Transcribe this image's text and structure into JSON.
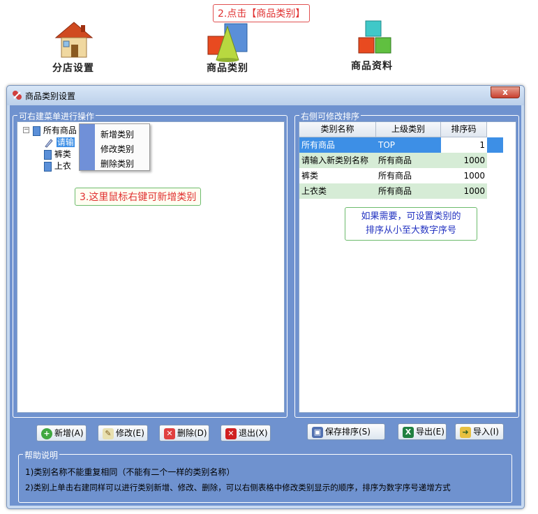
{
  "launcher": {
    "branch_label": "分店设置",
    "category_label": "商品类别",
    "goods_label": "商品资料"
  },
  "annotations": {
    "step2": "2.点击【商品类别】",
    "step3": "3.这里鼠标右键可新增类别",
    "sort_hint_line1": "如果需要，可设置类别的",
    "sort_hint_line2": "排序从小至大数字序号"
  },
  "window": {
    "title": "商品类别设置",
    "close_glyph": "x"
  },
  "tree_panel": {
    "title": "可右建菜单进行操作",
    "root": "所有商品",
    "children": [
      "请输",
      "裤类",
      "上衣"
    ]
  },
  "context_menu": {
    "items": [
      "新增类别",
      "修改类别",
      "删除类别"
    ]
  },
  "sort_panel": {
    "title": "右侧可修改排序",
    "columns": [
      "类别名称",
      "上级类别",
      "排序码"
    ],
    "rows": [
      {
        "name": "所有商品",
        "parent": "TOP",
        "order": "1"
      },
      {
        "name": "请输入新类别名称",
        "parent": "所有商品",
        "order": "1000"
      },
      {
        "name": "裤类",
        "parent": "所有商品",
        "order": "1000"
      },
      {
        "name": "上衣类",
        "parent": "所有商品",
        "order": "1000"
      }
    ]
  },
  "buttons": {
    "add": "新增(A)",
    "edit": "修改(E)",
    "delete": "删除(D)",
    "exit": "退出(X)",
    "save_sort": "保存排序(S)",
    "export": "导出(E)",
    "import": "导入(I)"
  },
  "help": {
    "title": "帮助说明",
    "line1": "1)类别名称不能重复相同（不能有二个一样的类别名称）",
    "line2": "2)类别上单击右建同样可以进行类别新增、修改、删除，可以右侧表格中修改类别显示的顺序，排序为数字序号递增方式"
  },
  "colors": {
    "window_bg": "#6f92cf",
    "selected_row": "#3d8fe6",
    "alt_row": "#d6ecd6"
  }
}
